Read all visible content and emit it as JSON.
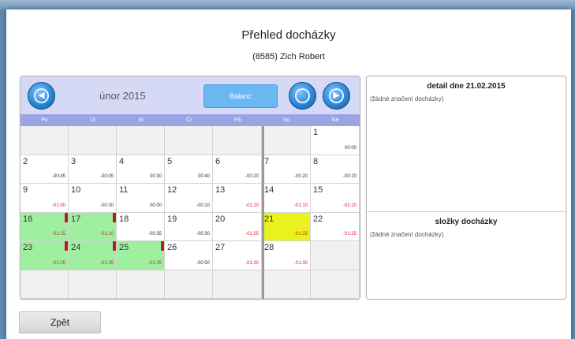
{
  "header": {
    "title": "Přehled docházky",
    "subtitle": "(8585) Zich Robert"
  },
  "calendar": {
    "month_label": "únor 2015",
    "balanc_label": "Balanc",
    "weekdays": [
      "Po",
      "Út",
      "St",
      "Čt",
      "Pá",
      "So",
      "Ne"
    ],
    "weeks": [
      [
        null,
        null,
        null,
        null,
        null,
        null,
        {
          "day": "1",
          "value": "00:00",
          "style": "day",
          "neg": false,
          "flag": false
        }
      ],
      [
        {
          "day": "2",
          "value": "-00:45",
          "style": "day",
          "neg": false,
          "flag": false
        },
        {
          "day": "3",
          "value": "-00:05",
          "style": "day",
          "neg": false,
          "flag": false
        },
        {
          "day": "4",
          "value": "00:30",
          "style": "day",
          "neg": false,
          "flag": false
        },
        {
          "day": "5",
          "value": "00:40",
          "style": "day",
          "neg": false,
          "flag": false
        },
        {
          "day": "6",
          "value": "-00:20",
          "style": "day",
          "neg": false,
          "flag": false
        },
        {
          "day": "7",
          "value": "-00:20",
          "style": "day",
          "neg": false,
          "flag": false
        },
        {
          "day": "8",
          "value": "-00:20",
          "style": "day",
          "neg": false,
          "flag": false
        }
      ],
      [
        {
          "day": "9",
          "value": "-01:00",
          "style": "day",
          "neg": true,
          "flag": false
        },
        {
          "day": "10",
          "value": "-00:30",
          "style": "day",
          "neg": false,
          "flag": false
        },
        {
          "day": "11",
          "value": "00:00",
          "style": "day",
          "neg": false,
          "flag": false
        },
        {
          "day": "12",
          "value": "-00:10",
          "style": "day",
          "neg": false,
          "flag": false
        },
        {
          "day": "13",
          "value": "-01:10",
          "style": "day",
          "neg": true,
          "flag": false
        },
        {
          "day": "14",
          "value": "-01:10",
          "style": "day",
          "neg": true,
          "flag": false
        },
        {
          "day": "15",
          "value": "-01:10",
          "style": "day",
          "neg": true,
          "flag": false
        }
      ],
      [
        {
          "day": "16",
          "value": "-01:15",
          "style": "green",
          "neg": true,
          "flag": true
        },
        {
          "day": "17",
          "value": "-01:10",
          "style": "green",
          "neg": true,
          "flag": true
        },
        {
          "day": "18",
          "value": "-00:35",
          "style": "day",
          "neg": false,
          "flag": false
        },
        {
          "day": "19",
          "value": "-00:30",
          "style": "day",
          "neg": false,
          "flag": false
        },
        {
          "day": "20",
          "value": "-01:25",
          "style": "day",
          "neg": true,
          "flag": false
        },
        {
          "day": "21",
          "value": "-01:25",
          "style": "yellow",
          "neg": true,
          "flag": false
        },
        {
          "day": "22",
          "value": "-01:25",
          "style": "day",
          "neg": true,
          "flag": false
        }
      ],
      [
        {
          "day": "23",
          "value": "-01:25",
          "style": "green",
          "neg": true,
          "flag": true
        },
        {
          "day": "24",
          "value": "-01:25",
          "style": "green",
          "neg": true,
          "flag": true
        },
        {
          "day": "25",
          "value": "-01:25",
          "style": "green",
          "neg": true,
          "flag": true
        },
        {
          "day": "26",
          "value": "-00:50",
          "style": "day",
          "neg": false,
          "flag": false
        },
        {
          "day": "27",
          "value": "-01:30",
          "style": "day",
          "neg": true,
          "flag": false
        },
        {
          "day": "28",
          "value": "-01:30",
          "style": "day",
          "neg": true,
          "flag": false
        },
        null
      ],
      [
        null,
        null,
        null,
        null,
        null,
        null,
        null
      ]
    ]
  },
  "detail": {
    "title": "detail dne 21.02.2015",
    "text": "(žádné značení docházky)"
  },
  "folders": {
    "title": "složky docházky",
    "text": "(žádné značení docházky)"
  },
  "back_label": "Zpět",
  "colors": {
    "highlight_green": "#9ef0a0",
    "selected_yellow": "#e9f21e",
    "header_band": "#d6d9f6",
    "weekday_band": "#9aa3e3",
    "negative_value": "#d22222",
    "marker_red": "#b81c1c",
    "balanc_button": "#6ab8f2"
  }
}
